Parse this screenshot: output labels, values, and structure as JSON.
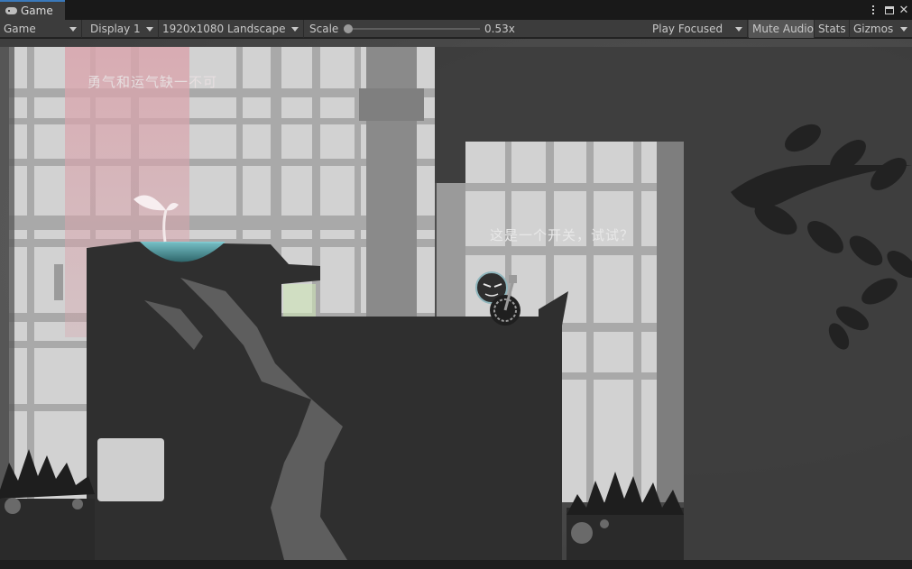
{
  "tab": {
    "title": "Game",
    "icon": "gamepad-icon"
  },
  "toolbar": {
    "view_mode": "Game",
    "display": "Display 1",
    "resolution": "1920x1080 Landscape",
    "scale_label": "Scale",
    "scale_value": "0.53x",
    "scale_fraction": 0.03,
    "play_mode": "Play Focused",
    "mute_audio": "Mute Audio",
    "stats": "Stats",
    "gizmos": "Gizmos"
  },
  "game": {
    "hint_courage": "勇气和运气缺一不可",
    "hint_switch": "这是一个开关，试试？"
  },
  "colors": {
    "panel": "#3c3c3c",
    "tab_accent": "#3a79bb",
    "ground": "#2f2f2f",
    "backdrop": "#4a4a4a",
    "pink_beam": "#d9a5ad"
  }
}
